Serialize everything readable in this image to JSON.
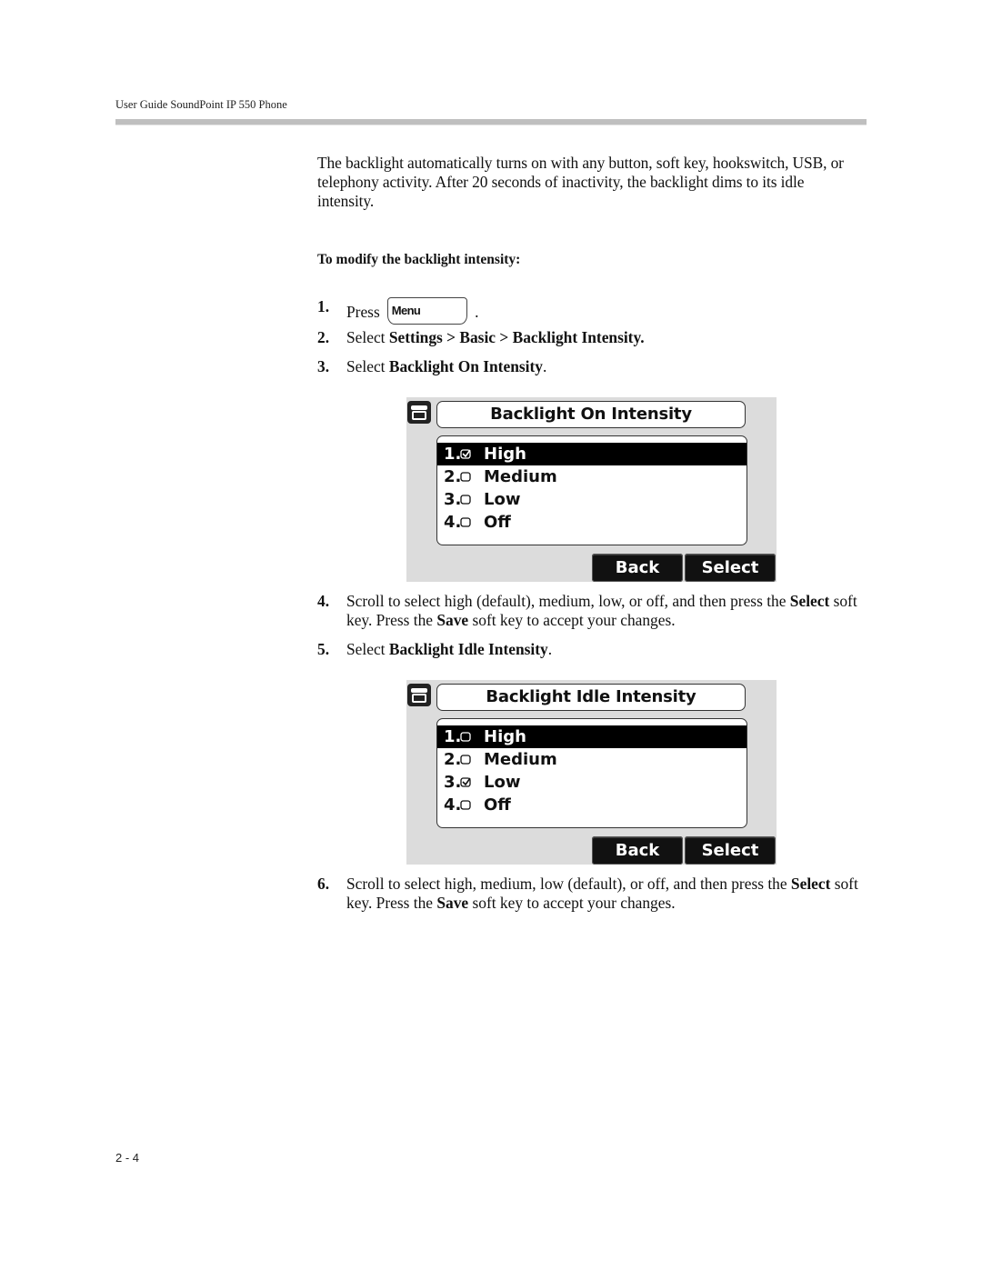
{
  "header": {
    "running_title": "User Guide SoundPoint IP 550 Phone"
  },
  "intro": "The backlight automatically turns on with any button, soft key, hookswitch, USB, or telephony activity. After 20 seconds of inactivity, the backlight dims to its idle intensity.",
  "procedure_title": "To modify the backlight intensity:",
  "steps": [
    {
      "num": "1.",
      "pre": "Press",
      "key_label": "Menu",
      "post": "."
    },
    {
      "num": "2.",
      "pre": "Select ",
      "bold": "Settings > Basic > Backlight Intensity.",
      "post": ""
    },
    {
      "num": "3.",
      "pre": "Select ",
      "bold": "Backlight On Intensity",
      "post": "."
    },
    {
      "num": "4.",
      "t1": "Scroll to select high (default), medium, low, or off, and then press the ",
      "b1": "Select",
      "t2": " soft key. Press the ",
      "b2": "Save",
      "t3": " soft key to accept your changes."
    },
    {
      "num": "5.",
      "pre": "Select ",
      "bold": "Backlight Idle Intensity",
      "post": "."
    },
    {
      "num": "6.",
      "t1": "Scroll to select high, medium, low (default), or off, and then press the ",
      "b1": "Select",
      "t2": " soft key. Press the ",
      "b2": "Save",
      "t3": " soft key to accept your changes."
    }
  ],
  "screens": [
    {
      "title": "Backlight On Intensity",
      "icon": "phone-handset-icon",
      "items": [
        {
          "index": "1.",
          "label": "High",
          "checked": true,
          "highlighted": true
        },
        {
          "index": "2.",
          "label": "Medium",
          "checked": false,
          "highlighted": false
        },
        {
          "index": "3.",
          "label": "Low",
          "checked": false,
          "highlighted": false
        },
        {
          "index": "4.",
          "label": "Off",
          "checked": false,
          "highlighted": false
        }
      ],
      "softkeys": [
        "Back",
        "Select"
      ]
    },
    {
      "title": "Backlight Idle Intensity",
      "icon": "phone-handset-icon",
      "items": [
        {
          "index": "1.",
          "label": "High",
          "checked": false,
          "highlighted": true
        },
        {
          "index": "2.",
          "label": "Medium",
          "checked": false,
          "highlighted": false
        },
        {
          "index": "3.",
          "label": "Low",
          "checked": true,
          "highlighted": false
        },
        {
          "index": "4.",
          "label": "Off",
          "checked": false,
          "highlighted": false
        }
      ],
      "softkeys": [
        "Back",
        "Select"
      ]
    }
  ],
  "footer": {
    "page_number": "2 - 4"
  }
}
